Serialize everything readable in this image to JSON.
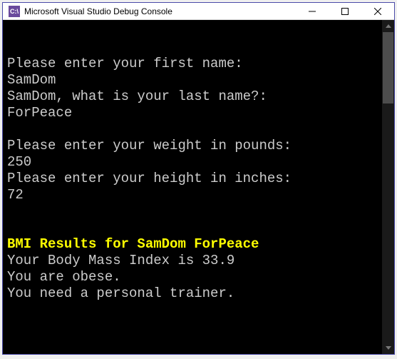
{
  "window": {
    "icon_text": "C:\\",
    "title": "Microsoft Visual Studio Debug Console"
  },
  "console": {
    "lines": [
      {
        "text": "Please enter your first name:",
        "color": "normal"
      },
      {
        "text": "SamDom",
        "color": "normal"
      },
      {
        "text": "SamDom, what is your last name?:",
        "color": "normal"
      },
      {
        "text": "ForPeace",
        "color": "normal"
      },
      {
        "text": "",
        "color": "normal"
      },
      {
        "text": "Please enter your weight in pounds:",
        "color": "normal"
      },
      {
        "text": "250",
        "color": "normal"
      },
      {
        "text": "Please enter your height in inches:",
        "color": "normal"
      },
      {
        "text": "72",
        "color": "normal"
      },
      {
        "text": "",
        "color": "normal"
      },
      {
        "text": "",
        "color": "normal"
      },
      {
        "text": "BMI Results for SamDom ForPeace",
        "color": "yellow"
      },
      {
        "text": "Your Body Mass Index is 33.9",
        "color": "normal"
      },
      {
        "text": "You are obese.",
        "color": "normal"
      },
      {
        "text": "You need a personal trainer.",
        "color": "normal"
      }
    ]
  }
}
